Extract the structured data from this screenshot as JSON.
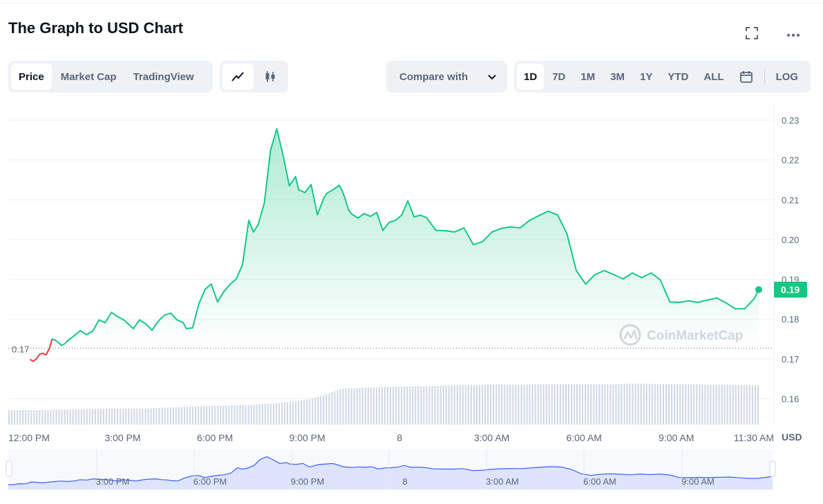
{
  "header": {
    "title": "The Graph to USD Chart"
  },
  "toolbar": {
    "view_tabs": [
      "Price",
      "Market Cap",
      "TradingView"
    ],
    "active_view": "Price",
    "chart_types": [
      "line-chart-icon",
      "candlestick-icon"
    ],
    "active_chart_type": "line-chart-icon",
    "compare_label": "Compare with",
    "ranges": [
      "1D",
      "7D",
      "1M",
      "3M",
      "1Y",
      "YTD",
      "ALL"
    ],
    "active_range": "1D",
    "log_label": "LOG"
  },
  "colors": {
    "up": "#16c784",
    "down": "#ea3943",
    "navigator": "#3861fb",
    "volume": "#cfd6e4",
    "grid": "#eff2f5",
    "axis_text": "#58667e"
  },
  "watermark": "CoinMarketCap",
  "chart_data": {
    "type": "line",
    "x_tick_labels": [
      "12:00 PM",
      "3:00 PM",
      "6:00 PM",
      "9:00 PM",
      "8",
      "3:00 AM",
      "6:00 AM",
      "9:00 AM",
      "11:30 AM"
    ],
    "y_tick_labels": [
      "0.23",
      "0.22",
      "0.21",
      "0.20",
      "0.19",
      "0.18",
      "0.17",
      "0.16"
    ],
    "ylim": [
      0.1535,
      0.2345
    ],
    "ylabel": "USD",
    "open_price_label": "0.17",
    "open_price": 0.1727,
    "current_price_label": "0.19",
    "current_price": 0.1874,
    "x_hours": [
      0,
      0.1,
      0.2,
      0.3,
      0.4,
      0.5,
      0.6,
      0.7,
      0.8,
      1.0,
      1.1,
      1.2,
      1.4,
      1.6,
      1.8,
      2.0,
      2.2,
      2.4,
      2.6,
      2.8,
      3.0,
      3.15,
      3.3,
      3.5,
      3.7,
      3.9,
      4.1,
      4.3,
      4.5,
      4.7,
      4.9,
      5.0,
      5.2,
      5.4,
      5.6,
      5.8,
      6.0,
      6.2,
      6.4,
      6.6,
      6.8,
      7.0,
      7.15,
      7.3,
      7.5,
      7.7,
      7.9,
      8.1,
      8.3,
      8.5,
      8.6,
      8.8,
      9.0,
      9.2,
      9.4,
      9.5,
      9.7,
      9.9,
      10.0,
      10.1,
      10.2,
      10.3,
      10.5,
      10.7,
      10.9,
      11.1,
      11.3,
      11.5,
      11.7,
      11.9,
      12.1,
      12.3,
      12.5,
      12.7,
      13.0,
      13.3,
      13.6,
      13.9,
      14.2,
      14.5,
      14.8,
      15.1,
      15.4,
      15.7,
      16.0,
      16.3,
      16.6,
      16.9,
      17.2,
      17.5,
      17.8,
      18.1,
      18.4,
      18.7,
      19.0,
      19.3,
      19.6,
      19.9,
      20.2,
      20.5,
      20.8,
      21.1,
      21.4,
      21.7,
      22.0,
      22.3,
      22.6,
      22.9,
      23.2,
      23.35
    ],
    "series": [
      {
        "values": [
          0.1698,
          0.1694,
          0.1701,
          0.1712,
          0.1714,
          0.171,
          0.1725,
          0.175,
          0.1747,
          0.1734,
          0.1738,
          0.1746,
          0.1758,
          0.1771,
          0.1761,
          0.177,
          0.1798,
          0.1791,
          0.1817,
          0.1806,
          0.1798,
          0.1787,
          0.1776,
          0.1798,
          0.1788,
          0.1772,
          0.1795,
          0.181,
          0.1815,
          0.1798,
          0.1791,
          0.1776,
          0.1778,
          0.1838,
          0.1875,
          0.1888,
          0.1843,
          0.1869,
          0.1887,
          0.1901,
          0.1937,
          0.2048,
          0.2019,
          0.2037,
          0.2092,
          0.2225,
          0.2278,
          0.2212,
          0.2135,
          0.2158,
          0.2125,
          0.2118,
          0.2138,
          0.2062,
          0.2103,
          0.2116,
          0.2125,
          0.2136,
          0.2122,
          0.21,
          0.2074,
          0.2064,
          0.2054,
          0.2065,
          0.2058,
          0.2068,
          0.2023,
          0.2043,
          0.2048,
          0.2061,
          0.2097,
          0.2057,
          0.2061,
          0.2055,
          0.2023,
          0.2022,
          0.2019,
          0.2029,
          0.1987,
          0.1995,
          0.2019,
          0.2028,
          0.2032,
          0.2029,
          0.2048,
          0.206,
          0.2071,
          0.2062,
          0.2015,
          0.1922,
          0.1888,
          0.1912,
          0.1922,
          0.1912,
          0.1901,
          0.1916,
          0.1904,
          0.1916,
          0.1898,
          0.1843,
          0.1842,
          0.1846,
          0.1842,
          0.1848,
          0.1853,
          0.1841,
          0.1826,
          0.1826,
          0.1851,
          0.1874
        ]
      }
    ],
    "volume_heights": [
      0.28,
      0.28,
      0.28,
      0.29,
      0.29,
      0.3,
      0.3,
      0.31,
      0.31,
      0.32,
      0.33,
      0.34,
      0.35,
      0.36,
      0.37,
      0.38,
      0.4,
      0.42,
      0.45,
      0.5,
      0.6,
      0.7,
      0.71,
      0.72,
      0.73,
      0.74,
      0.74,
      0.75,
      0.76,
      0.76,
      0.77,
      0.77,
      0.77,
      0.78,
      0.78,
      0.78,
      0.78,
      0.78,
      0.78,
      0.79,
      0.79,
      0.78,
      0.78,
      0.78,
      0.77,
      0.77,
      0.76,
      0.76
    ],
    "navigator": {
      "x_tick_labels": [
        "3:00 PM",
        "6:00 PM",
        "9:00 PM",
        "8",
        "3:00 AM",
        "6:00 AM",
        "9:00 AM"
      ]
    }
  }
}
